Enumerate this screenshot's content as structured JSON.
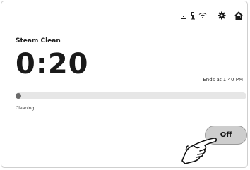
{
  "header": {
    "icons": [
      "lock-icon",
      "probe-icon",
      "wifi-icon",
      "gear-icon",
      "home-icon"
    ]
  },
  "cycle": {
    "mode": "Steam Clean",
    "time_remaining": "0:20",
    "ends_at": "Ends at 1:40 PM",
    "progress": 0.0,
    "status": "Cleaning..."
  },
  "controls": {
    "off_label": "Off"
  },
  "colors": {
    "accent": "#1c1c1c",
    "track": "#e6e6e6",
    "knob": "#6a6a6a",
    "button_bg": "#cdcdcd"
  }
}
